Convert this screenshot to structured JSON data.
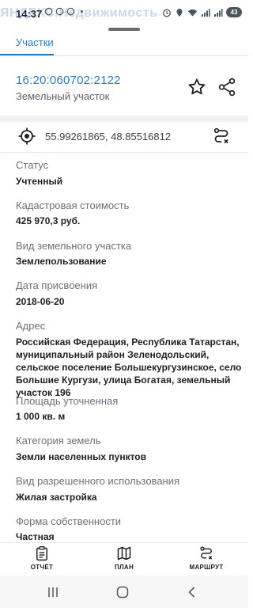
{
  "status_bar": {
    "time": "14:37",
    "watermark": "ЯНДЕКС.Недвижимость",
    "battery": "43"
  },
  "tab": {
    "label": "Участки"
  },
  "header": {
    "cadastral_number": "16:20:060702:2122",
    "object_type": "Земельный участок"
  },
  "coordinates": {
    "text": "55.99261865, 48.85516812"
  },
  "fields": [
    {
      "label": "Статус",
      "value": "Учтенный"
    },
    {
      "label": "Кадастровая стоимость",
      "value": "425 970,3 руб."
    },
    {
      "label": "Вид земельного участка",
      "value": "Землепользование"
    },
    {
      "label": "Дата присвоения",
      "value": "2018-06-20"
    },
    {
      "label": "Адрес",
      "value": "Российская Федерация, Республика Татарстан, муниципальный район Зеленодольский, сельское поселение Большекургузинское, село Большие Кургузи, улица Богатая, земельный участок 196"
    },
    {
      "label": "Площадь уточненная",
      "value": "1 000 кв. м"
    },
    {
      "label": "Категория земель",
      "value": "Земли населенных пунктов"
    },
    {
      "label": "Вид разрешенного использования",
      "value": "Жилая застройка"
    },
    {
      "label": "Форма собственности",
      "value": "Частная"
    }
  ],
  "bottom_nav": {
    "report": "ОТЧЁТ",
    "plan": "ПЛАН",
    "route": "МАРШРУТ"
  },
  "colors": {
    "accent": "#2b7bb9",
    "text": "#202124",
    "muted": "#6b7075"
  },
  "icons": [
    "target-icon",
    "star-icon",
    "share-icon",
    "route-icon",
    "report-icon",
    "map-icon",
    "recents-icon",
    "home-icon",
    "back-icon"
  ]
}
